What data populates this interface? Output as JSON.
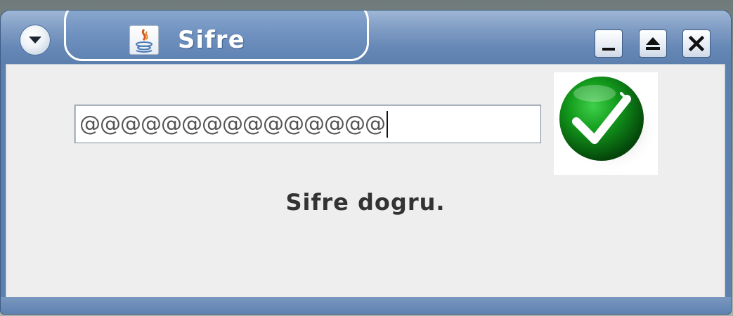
{
  "window": {
    "title": "Sifre",
    "title_icon": "java-icon",
    "controls": {
      "menu_icon": "chevron-down-icon",
      "minimize_icon": "minimize-icon",
      "maximize_icon": "maximize-icon",
      "close_icon": "close-icon"
    }
  },
  "form": {
    "password_value": "@@@@@@@@@@@@@@@",
    "status_icon": "checkmark-icon",
    "status_message": "Sifre dogru."
  },
  "colors": {
    "titlebar": "#6688b6",
    "content_background": "#eeeeee",
    "status_icon_green": "#0f7a12"
  }
}
